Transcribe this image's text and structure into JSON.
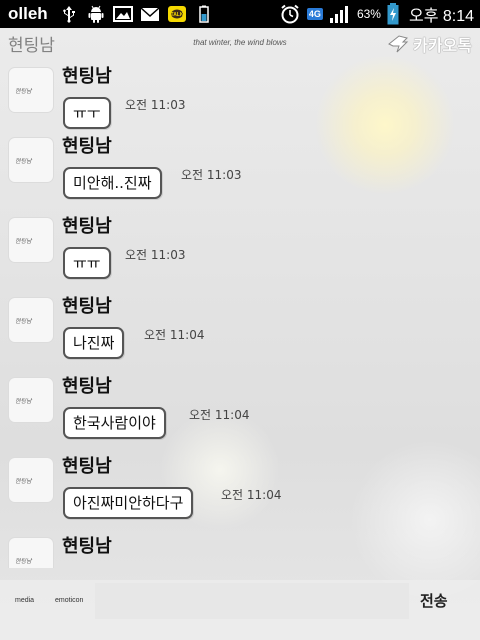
{
  "statusbar": {
    "carrier": "olleh",
    "network_badge": "4G",
    "battery_percent": "63%",
    "time": "오후 8:14",
    "icons": [
      "usb-icon",
      "android-icon",
      "image-icon",
      "mail-icon",
      "kakaotalk-icon",
      "battery-saver-icon",
      "alarm-clock-icon",
      "signal-icon",
      "battery-icon"
    ]
  },
  "header": {
    "title": "현팅남",
    "subtitle": "that winter, the wind blows",
    "brand": "카카오톡"
  },
  "messages": [
    {
      "sender": "현팅남",
      "text": "ㅠㅜ",
      "time": "오전 11:03"
    },
    {
      "sender": "현팅남",
      "text": "미안해..진짜",
      "time": "오전 11:03"
    },
    {
      "sender": "현팅남",
      "text": "ㅠㅠ",
      "time": "오전 11:03"
    },
    {
      "sender": "현팅남",
      "text": "나진짜",
      "time": "오전 11:04"
    },
    {
      "sender": "현팅남",
      "text": "한국사람이야",
      "time": "오전 11:04"
    },
    {
      "sender": "현팅남",
      "text": "아진짜미안하다구",
      "time": "오전 11:04"
    },
    {
      "sender": "현팅남",
      "text": "",
      "time": ""
    }
  ],
  "avatar_text": "현팅남",
  "inputbar": {
    "media_label": "media",
    "emoticon_label": "emoticon",
    "send_label": "전송",
    "input_value": ""
  }
}
